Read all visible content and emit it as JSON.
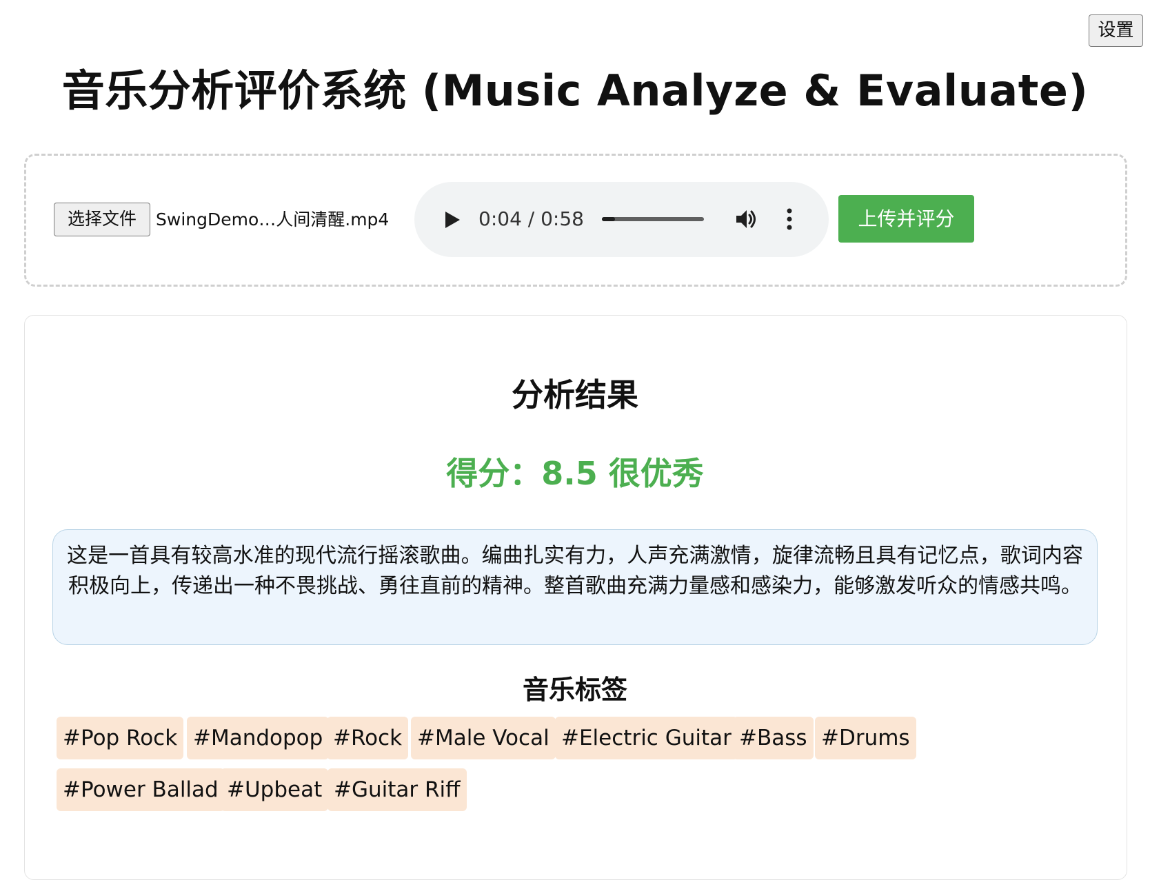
{
  "header": {
    "settings_label": "设置",
    "title": "音乐分析评价系统 (Music Analyze & Evaluate)"
  },
  "upload": {
    "choose_file_label": "选择文件",
    "file_name": "SwingDemo…人间清醒.mp4",
    "submit_label": "上传并评分"
  },
  "player": {
    "time": "0:04 / 0:58",
    "progress_fraction": 0.128,
    "icons": [
      "play-icon",
      "volume-icon",
      "more-options-icon"
    ]
  },
  "result": {
    "heading": "分析结果",
    "score_text": "得分：8.5 很优秀",
    "score_color": "#4caf50",
    "summary": "这是一首具有较高水准的现代流行摇滚歌曲。编曲扎实有力，人声充满激情，旋律流畅且具有记忆点，歌词内容积极向上，传递出一种不畏挑战、勇往直前的精神。整首歌曲充满力量感和感染力，能够激发听众的情感共鸣。",
    "tags_heading": "音乐标签",
    "tags": [
      "#Pop Rock",
      "#Mandopop",
      "#Rock",
      "#Male Vocal",
      "#Electric Guitar",
      "#Bass",
      "#Drums",
      "#Power Ballad",
      "#Upbeat",
      "#Guitar Riff"
    ]
  },
  "colors": {
    "accent_green": "#4caf50",
    "summary_background": "#edf5fd",
    "tag_background": "#fbe6d4"
  }
}
